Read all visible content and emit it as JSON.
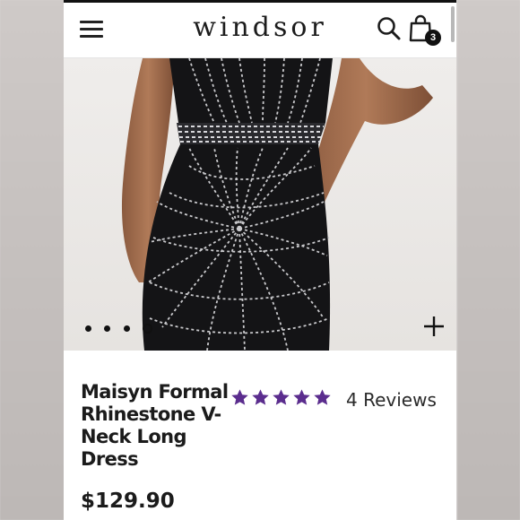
{
  "header": {
    "logo": "WINDSOR",
    "cart_count": "3",
    "icons": [
      "menu-icon",
      "search-icon",
      "shopping-bag-icon"
    ]
  },
  "gallery": {
    "image_count": 4,
    "active_index": 3,
    "zoom_icon": "plus-icon"
  },
  "product": {
    "title": "Maisyn Formal Rhinestone V-Neck Long Dress",
    "rating": 5,
    "reviews_label": "4 Reviews",
    "price": "$129.90"
  },
  "colors": {
    "star": "#5b2d8e",
    "text": "#1b1b1b",
    "dress": "#141416",
    "rhinestone": "#c9c9cc"
  }
}
